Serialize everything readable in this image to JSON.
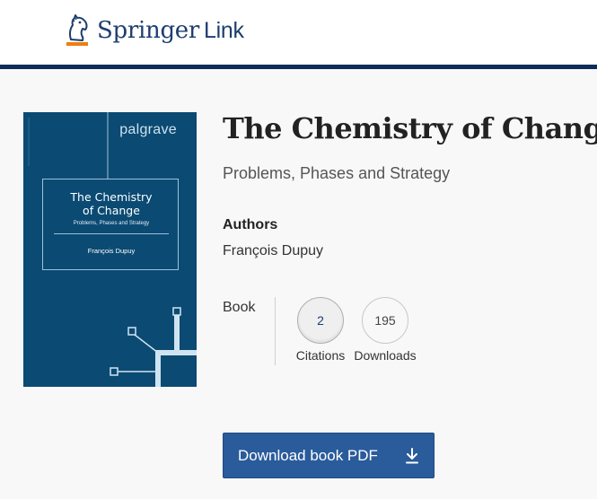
{
  "header": {
    "logo_brand": "Springer",
    "logo_suffix": "Link",
    "accent_color": "#0c2d57"
  },
  "book": {
    "cover": {
      "publisher": "palgrave",
      "title_line1": "The Chemistry",
      "title_line2": "of Change",
      "subtitle": "Problems, Phases and Strategy",
      "author": "François Dupuy",
      "background_color": "#0b4a73"
    },
    "title": "The Chemistry of Change",
    "subtitle": "Problems, Phases and Strategy",
    "authors_label": "Authors",
    "author": "François Dupuy",
    "type": "Book",
    "metrics": {
      "citations_value": "2",
      "citations_label": "Citations",
      "downloads_value": "195",
      "downloads_label": "Downloads"
    }
  },
  "actions": {
    "download_label": "Download book PDF",
    "button_color": "#2a5b9b"
  },
  "icons": {
    "logo": "springer-horse-icon",
    "download": "download-arrow-icon"
  }
}
